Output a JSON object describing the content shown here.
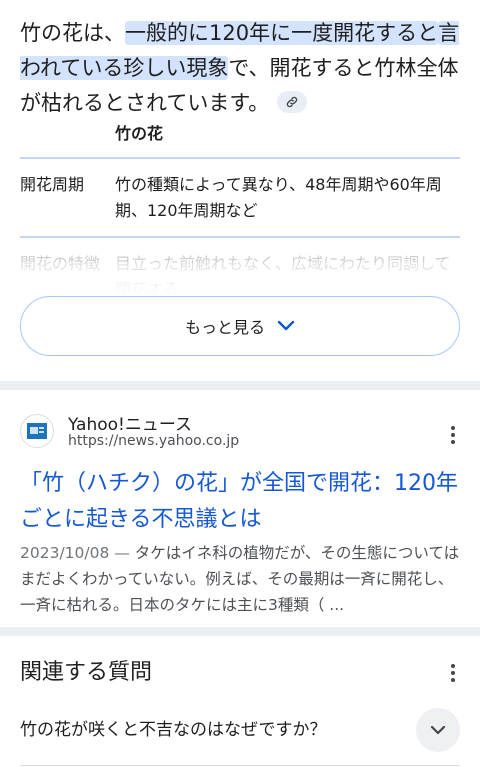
{
  "answer": {
    "part1": "竹の花は、",
    "highlight1": "一般的に120年に一度開花すると",
    "highlight2": "言われている珍しい現象",
    "part2": "で、開花すると竹林全体が枯れるとされています。",
    "link_icon": "link-icon"
  },
  "table": {
    "header": "竹の花",
    "rows": [
      {
        "label": "開花周期",
        "value": "竹の種類によって異なり、48年周期や60年周期、120年周期など"
      },
      {
        "label": "開花の特徴",
        "value": "目立った前触れもなく、広域にわたり同調して開花する"
      }
    ]
  },
  "more_button": {
    "label": "もっと見る",
    "icon": "chevron-down-icon"
  },
  "result": {
    "site_name": "Yahoo!ニュース",
    "site_url": "https://news.yahoo.co.jp",
    "title": "「竹（ハチク）の花」が全国で開花：120年ごとに起きる不思議とは",
    "date": "2023/10/08 — ",
    "snippet": "タケはイネ科の植物だが、その生態についてはまだよくわかっていない。例えば、その最期は一斉に開花し、一斉に枯れる。日本のタケには主に3種類（ ..."
  },
  "related": {
    "title": "関連する質問",
    "questions": [
      "竹の花が咲くと不吉なのはなぜですか？"
    ]
  },
  "colors": {
    "accent": "#1558d6",
    "highlight": "#d3e3fd",
    "button_border": "#a8c7fa"
  }
}
